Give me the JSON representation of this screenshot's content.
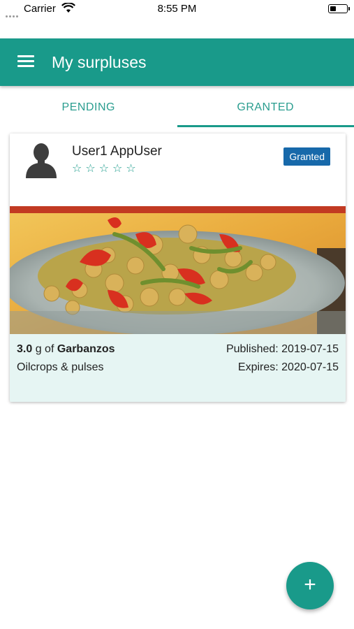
{
  "status_bar": {
    "carrier": "Carrier",
    "time": "8:55 PM",
    "icons": [
      "signal-icon",
      "wifi-icon",
      "battery-icon"
    ]
  },
  "app_bar": {
    "title": "My surpluses",
    "menu_icon": "menu-icon",
    "color": "#199a8a"
  },
  "tabs": [
    {
      "label": "PENDING",
      "active": false
    },
    {
      "label": "GRANTED",
      "active": true
    }
  ],
  "card": {
    "user_name": "User1 AppUser",
    "rating_stars": "☆☆☆☆☆",
    "rating_value": 0,
    "rating_max": 5,
    "status_badge": "Granted",
    "badge_color": "#1769aa",
    "quantity": "3.0",
    "unit_of": "g of",
    "product": "Garbanzos",
    "category": "Oilcrops & pulses",
    "published": "Published: 2019-07-15",
    "expires": "Expires: 2020-07-15",
    "footer_color": "#e6f5f3"
  },
  "fab": {
    "label": "+",
    "icon": "add-icon"
  }
}
